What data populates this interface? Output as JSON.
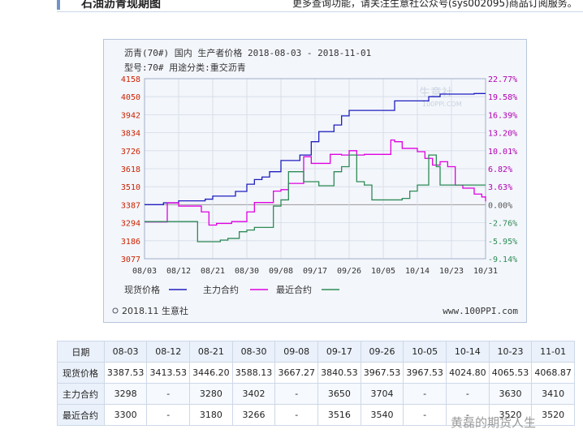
{
  "header": {
    "title": "石油沥青现期图",
    "notice": "更多查询功能，请关注生意社公众号(sys002095)商品订阅服务。"
  },
  "colors": {
    "spot": "#1f1fbf",
    "main": "#e000e0",
    "near": "#2e8b57",
    "left_axis": "#cc2200",
    "right_axis": "#b000b0",
    "near_axis": "#2e8b57"
  },
  "chart_data": {
    "type": "line",
    "title": "沥青(70#) 国内 生产者价格 2018-08-03 - 2018-11-01",
    "subtitle": "型号:70# 用途分类:重交沥青",
    "x_tick_labels": [
      "08/03",
      "08/12",
      "08/21",
      "08/30",
      "09/08",
      "09/17",
      "09/26",
      "10/05",
      "10/14",
      "10/23",
      "10/31"
    ],
    "y_left_ticks": [
      4158,
      4050,
      3942,
      3834,
      3726,
      3618,
      3510,
      3387,
      3294,
      3186,
      3077
    ],
    "y_right_ticks": [
      "22.77%",
      "19.58%",
      "16.39%",
      "13.20%",
      "10.01%",
      "6.82%",
      "3.63%",
      "0.00%",
      "-2.76%",
      "-5.95%",
      "-9.14%"
    ],
    "ylim": [
      3077,
      4158
    ],
    "x_range": [
      0,
      90
    ],
    "legend": [
      "现货价格",
      "主力合约",
      "最近合约"
    ],
    "legend_placement": "bottom",
    "series": [
      {
        "name": "现货价格",
        "color": "#1f1fbf",
        "points": [
          [
            0,
            3387.53
          ],
          [
            2,
            3387.53
          ],
          [
            5,
            3400
          ],
          [
            9,
            3413.53
          ],
          [
            12,
            3413.53
          ],
          [
            16,
            3425
          ],
          [
            18,
            3446.2
          ],
          [
            20,
            3446.2
          ],
          [
            24,
            3478
          ],
          [
            27,
            3525
          ],
          [
            29,
            3553
          ],
          [
            31,
            3568.13
          ],
          [
            33,
            3600
          ],
          [
            36,
            3667.27
          ],
          [
            38,
            3667.27
          ],
          [
            41,
            3700
          ],
          [
            44,
            3780
          ],
          [
            46,
            3840.53
          ],
          [
            48,
            3840.53
          ],
          [
            50,
            3880
          ],
          [
            52,
            3935
          ],
          [
            54,
            3967.53
          ],
          [
            56,
            3967.53
          ],
          [
            59,
            3967.53
          ],
          [
            62,
            3967.53
          ],
          [
            64,
            3967.53
          ],
          [
            66,
            4024.8
          ],
          [
            70,
            4024.8
          ],
          [
            73,
            4024.8
          ],
          [
            75,
            4050
          ],
          [
            78,
            4065.53
          ],
          [
            80,
            4065.53
          ],
          [
            83,
            4065.53
          ],
          [
            85,
            4065.53
          ],
          [
            87,
            4068.87
          ],
          [
            90,
            4068.87
          ]
        ]
      },
      {
        "name": "主力合约",
        "color": "#e000e0",
        "points": [
          [
            0,
            3298
          ],
          [
            4,
            3298
          ],
          [
            6,
            3400
          ],
          [
            9,
            3380
          ],
          [
            13,
            3380
          ],
          [
            15,
            3350
          ],
          [
            17,
            3280
          ],
          [
            19,
            3290
          ],
          [
            23,
            3300
          ],
          [
            25,
            3300
          ],
          [
            27,
            3350
          ],
          [
            29,
            3402
          ],
          [
            31,
            3402
          ],
          [
            34,
            3480
          ],
          [
            36,
            3490
          ],
          [
            38,
            3530
          ],
          [
            40,
            3530
          ],
          [
            42,
            3690
          ],
          [
            43,
            3690
          ],
          [
            44,
            3650
          ],
          [
            47,
            3650
          ],
          [
            49,
            3704
          ],
          [
            50,
            3704
          ],
          [
            52,
            3700
          ],
          [
            54,
            3726
          ],
          [
            56,
            3700
          ],
          [
            58,
            3704
          ],
          [
            60,
            3704
          ],
          [
            63,
            3704
          ],
          [
            65,
            3790
          ],
          [
            66,
            3780
          ],
          [
            68,
            3740
          ],
          [
            70,
            3740
          ],
          [
            72,
            3720
          ],
          [
            74,
            3680
          ],
          [
            76,
            3640
          ],
          [
            78,
            3660
          ],
          [
            80,
            3630
          ],
          [
            82,
            3520
          ],
          [
            84,
            3500
          ],
          [
            86,
            3500
          ],
          [
            87,
            3460
          ],
          [
            89,
            3440
          ],
          [
            90,
            3410
          ]
        ]
      },
      {
        "name": "最近合约",
        "color": "#2e8b57",
        "points": [
          [
            0,
            3300
          ],
          [
            4,
            3300
          ],
          [
            7,
            3300
          ],
          [
            12,
            3300
          ],
          [
            14,
            3180
          ],
          [
            16,
            3180
          ],
          [
            18,
            3180
          ],
          [
            20,
            3190
          ],
          [
            22,
            3200
          ],
          [
            25,
            3240
          ],
          [
            27,
            3250
          ],
          [
            29,
            3266
          ],
          [
            31,
            3266
          ],
          [
            34,
            3380
          ],
          [
            36,
            3420
          ],
          [
            38,
            3600
          ],
          [
            40,
            3600
          ],
          [
            42,
            3540
          ],
          [
            44,
            3540
          ],
          [
            46,
            3516
          ],
          [
            48,
            3516
          ],
          [
            50,
            3600
          ],
          [
            52,
            3630
          ],
          [
            54,
            3700
          ],
          [
            56,
            3540
          ],
          [
            58,
            3520
          ],
          [
            60,
            3420
          ],
          [
            62,
            3420
          ],
          [
            64,
            3420
          ],
          [
            66,
            3420
          ],
          [
            68,
            3430
          ],
          [
            70,
            3480
          ],
          [
            72,
            3520
          ],
          [
            74,
            3520
          ],
          [
            75,
            3700
          ],
          [
            76,
            3700
          ],
          [
            77,
            3630
          ],
          [
            78,
            3520
          ],
          [
            80,
            3520
          ],
          [
            82,
            3520
          ],
          [
            84,
            3520
          ],
          [
            86,
            3520
          ],
          [
            88,
            3520
          ],
          [
            90,
            3520
          ]
        ]
      }
    ]
  },
  "chart_footer": {
    "left": "2018.11 生意社",
    "right": "www.100PPI.com",
    "logo_text": "生意社",
    "logo_sub": "100PPI.COM"
  },
  "table": {
    "columns": [
      "日期",
      "08-03",
      "08-12",
      "08-21",
      "08-30",
      "09-08",
      "09-17",
      "09-26",
      "10-05",
      "10-14",
      "10-23",
      "11-01"
    ],
    "rows": [
      [
        "现货价格",
        "3387.53",
        "3413.53",
        "3446.20",
        "3588.13",
        "3667.27",
        "3840.53",
        "3967.53",
        "3967.53",
        "4024.80",
        "4065.53",
        "4068.87"
      ],
      [
        "主力合约",
        "3298",
        "-",
        "3280",
        "3402",
        "-",
        "3650",
        "3704",
        "-",
        "-",
        "3630",
        "3410"
      ],
      [
        "最近合约",
        "3300",
        "-",
        "3180",
        "3266",
        "-",
        "3516",
        "3540",
        "-",
        "-",
        "3520",
        "3520"
      ]
    ]
  },
  "watermark": "黄磊的期货人生"
}
